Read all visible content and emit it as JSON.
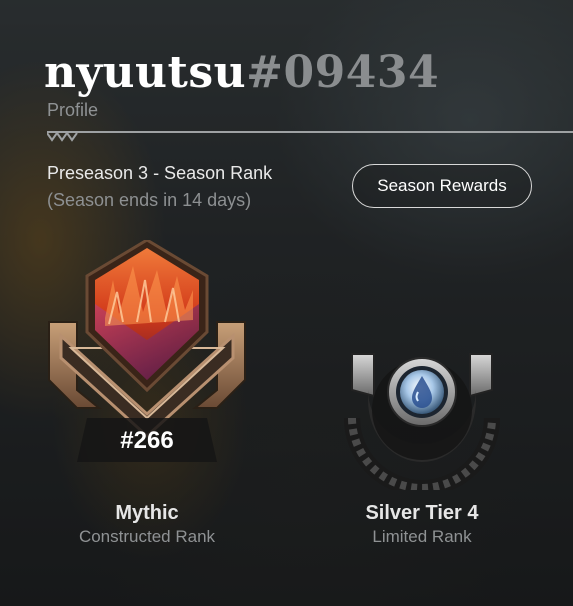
{
  "profile": {
    "username": "nyuutsu",
    "tag": "#09434",
    "subtitle": "Profile"
  },
  "season": {
    "title": "Preseason 3 - Season Rank",
    "ends": "(Season ends in 14 days)",
    "rewards_button": "Season Rewards"
  },
  "ranks": {
    "constructed": {
      "position": "#266",
      "tier": "Mythic",
      "format": "Constructed Rank",
      "icon": "mythic-crest-icon"
    },
    "limited": {
      "tier": "Silver Tier 4",
      "format": "Limited Rank",
      "icon": "silver-crest-icon"
    }
  },
  "colors": {
    "tag": "#8a8d8f",
    "mythic_gem": "#e0502a",
    "silver_gem": "#a8c8e8"
  }
}
